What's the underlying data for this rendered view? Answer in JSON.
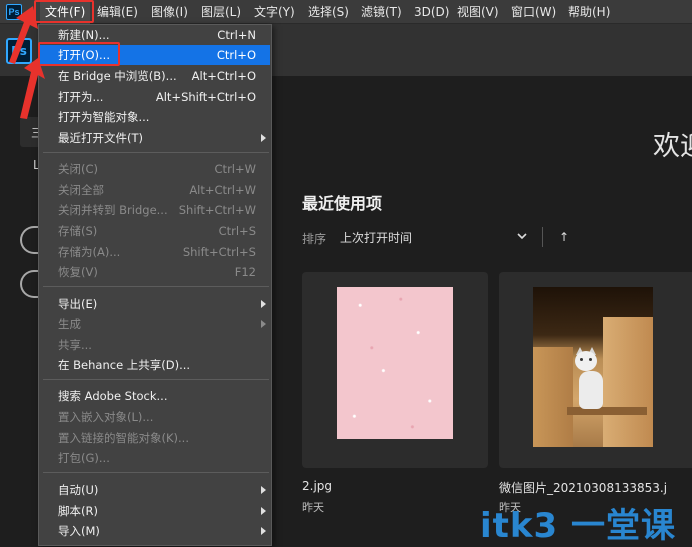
{
  "app": {
    "logo": "Ps"
  },
  "menubar": {
    "items": [
      "文件(F)",
      "编辑(E)",
      "图像(I)",
      "图层(L)",
      "文字(Y)",
      "选择(S)",
      "滤镜(T)",
      "3D(D)",
      "视图(V)",
      "窗口(W)",
      "帮助(H)"
    ]
  },
  "file_menu": {
    "new": {
      "label": "新建(N)...",
      "shortcut": "Ctrl+N"
    },
    "open": {
      "label": "打开(O)...",
      "shortcut": "Ctrl+O"
    },
    "browse_bridge": {
      "label": "在 Bridge 中浏览(B)...",
      "shortcut": "Alt+Ctrl+O"
    },
    "open_as": {
      "label": "打开为...",
      "shortcut": "Alt+Shift+Ctrl+O"
    },
    "open_smart": {
      "label": "打开为智能对象..."
    },
    "recent": {
      "label": "最近打开文件(T)"
    },
    "close": {
      "label": "关闭(C)",
      "shortcut": "Ctrl+W"
    },
    "close_all": {
      "label": "关闭全部",
      "shortcut": "Alt+Ctrl+W"
    },
    "close_bridge": {
      "label": "关闭并转到 Bridge...",
      "shortcut": "Shift+Ctrl+W"
    },
    "save": {
      "label": "存储(S)",
      "shortcut": "Ctrl+S"
    },
    "save_as": {
      "label": "存储为(A)...",
      "shortcut": "Shift+Ctrl+S"
    },
    "revert": {
      "label": "恢复(V)",
      "shortcut": "F12"
    },
    "export": {
      "label": "导出(E)"
    },
    "generate": {
      "label": "生成"
    },
    "share": {
      "label": "共享..."
    },
    "behance": {
      "label": "在 Behance 上共享(D)..."
    },
    "stock": {
      "label": "搜索 Adobe Stock..."
    },
    "place_embedded": {
      "label": "置入嵌入对象(L)..."
    },
    "place_linked": {
      "label": "置入链接的智能对象(K)..."
    },
    "package": {
      "label": "打包(G)..."
    },
    "automate": {
      "label": "自动(U)"
    },
    "scripts": {
      "label": "脚本(R)"
    },
    "import": {
      "label": "导入(M)"
    }
  },
  "home": {
    "welcome": "欢迎",
    "left_tab": "三",
    "left_label": "L",
    "recent_title": "最近使用项",
    "sort_label": "排序",
    "sort_value": "上次打开时间",
    "sort_direction": "↑",
    "files": [
      {
        "name": "2.jpg",
        "date": "昨天"
      },
      {
        "name": "微信图片_20210308133853.j",
        "date": "昨天"
      }
    ]
  },
  "watermark": "itk3 一堂课",
  "colors": {
    "accent": "#1473e6",
    "annotation": "#e8322c",
    "brand": "#31a8ff"
  }
}
